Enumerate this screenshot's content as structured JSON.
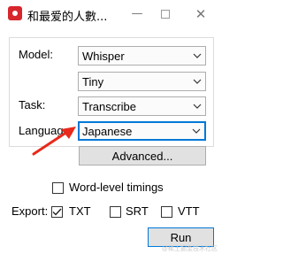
{
  "window": {
    "title": "和最爱的人數...",
    "minimize_glyph": "—",
    "close_glyph": "✕"
  },
  "form": {
    "model_label": "Model:",
    "model_value": "Whisper",
    "size_value": "Tiny",
    "task_label": "Task:",
    "task_value": "Transcribe",
    "language_label": "Language:",
    "language_value": "Japanese",
    "advanced_button": "Advanced..."
  },
  "options": {
    "word_timings_label": "Word-level timings",
    "word_timings_checked": false
  },
  "export": {
    "label": "Export:",
    "txt_label": "TXT",
    "txt_checked": true,
    "srt_label": "SRT",
    "srt_checked": false,
    "vtt_label": "VTT",
    "vtt_checked": false
  },
  "run_button": "Run",
  "watermark": "@稀土掘金技术社区",
  "colors": {
    "annotation_arrow": "#e8291c",
    "app_icon": "#d7262c",
    "focus_border": "#0078d7"
  },
  "icons": {
    "app": "app-icon",
    "dropdown": "chevron-down-icon",
    "check": "checkmark-icon"
  }
}
